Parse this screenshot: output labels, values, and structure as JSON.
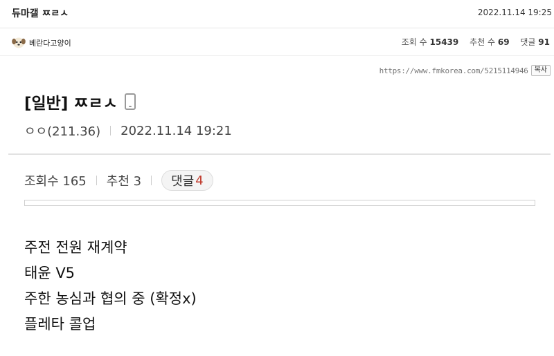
{
  "header": {
    "board_title": "듀마갤 ㅉㄹㅅ",
    "timestamp": "2022.11.14 19:25"
  },
  "author": {
    "nickname": "베란다고양이",
    "avatar_icon": "puppy-avatar-icon"
  },
  "stats": {
    "views_label": "조회 수",
    "views_value": "15439",
    "recommend_label": "추천 수",
    "recommend_value": "69",
    "comments_label": "댓글",
    "comments_value": "91"
  },
  "url_row": {
    "url": "https://www.fmkorea.com/5215114946",
    "copy_label": "복사"
  },
  "post": {
    "title": "[일반] ㅉㄹㅅ",
    "device_icon": "mobile-phone-icon",
    "author_ip": "ㅇㅇ(211.36)",
    "datetime": "2022.11.14 19:21",
    "views": "조회수 165",
    "recommends": "추천 3",
    "reply_label": "댓글",
    "reply_count": "4",
    "reply_count_color": "#c0392b",
    "lines": [
      "주전 전원 재계약",
      "태윤 V5",
      "주한 농심과 협의 중 (확정x)",
      "플레타 콜업"
    ]
  }
}
